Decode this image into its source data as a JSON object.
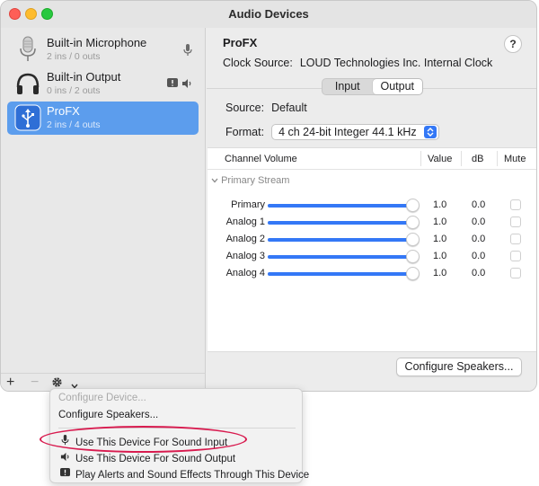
{
  "window": {
    "title": "Audio Devices"
  },
  "devices": [
    {
      "name": "Built-in Microphone",
      "io": "2 ins / 0 outs",
      "icon": "microphone-icon"
    },
    {
      "name": "Built-in Output",
      "io": "0 ins / 2 outs",
      "icon": "headphones-icon"
    },
    {
      "name": "ProFX",
      "io": "2 ins / 4 outs",
      "icon": "usb-icon"
    }
  ],
  "sidebar_bottom": {
    "add": "+",
    "remove": "−",
    "gear": "⚙",
    "chevron": "⌄"
  },
  "detail": {
    "device_title": "ProFX",
    "help": "?",
    "clock_label": "Clock Source:",
    "clock_value": "LOUD Technologies Inc. Internal Clock",
    "tabs": [
      "Input",
      "Output"
    ],
    "active_tab": "Output",
    "source_label": "Source:",
    "source_value": "Default",
    "format_label": "Format:",
    "format_value": "4 ch 24-bit Integer 44.1 kHz",
    "table": {
      "headers": {
        "channel": "Channel Volume",
        "value": "Value",
        "db": "dB",
        "mute": "Mute"
      },
      "group": "Primary Stream",
      "rows": [
        {
          "label": "Primary",
          "level": 1.0,
          "value": "1.0",
          "db": "0.0",
          "muted": false
        },
        {
          "label": "Analog 1",
          "level": 1.0,
          "value": "1.0",
          "db": "0.0",
          "muted": false
        },
        {
          "label": "Analog 2",
          "level": 1.0,
          "value": "1.0",
          "db": "0.0",
          "muted": false
        },
        {
          "label": "Analog 3",
          "level": 1.0,
          "value": "1.0",
          "db": "0.0",
          "muted": false
        },
        {
          "label": "Analog 4",
          "level": 1.0,
          "value": "1.0",
          "db": "0.0",
          "muted": false
        }
      ]
    },
    "configure_button": "Configure Speakers..."
  },
  "menu": {
    "items": [
      {
        "label": "Configure Device...",
        "enabled": false
      },
      {
        "label": "Configure Speakers...",
        "enabled": true
      },
      {
        "label": "Use This Device For Sound Input",
        "enabled": true,
        "icon": "microphone-icon"
      },
      {
        "label": "Use This Device For Sound Output",
        "enabled": true,
        "icon": "speaker-icon"
      },
      {
        "label": "Play Alerts and Sound Effects Through This Device",
        "enabled": true,
        "icon": "alert-icon"
      }
    ]
  },
  "colors": {
    "accent": "#3478f6",
    "selection": "#5c9ded",
    "annotation": "#d81b4f"
  }
}
